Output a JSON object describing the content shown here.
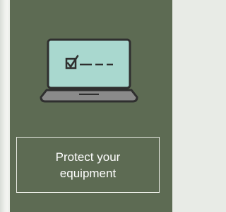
{
  "card": {
    "caption": "Protect your\nequipment",
    "icon": "laptop-checklist-icon"
  },
  "colors": {
    "card_background": "#5d6b53",
    "laptop_screen": "#a9d8cf",
    "laptop_outline": "#2f2f2f",
    "laptop_base": "#8a8a8a",
    "caption_border": "#e8ebe3",
    "caption_text": "#ffffff"
  }
}
